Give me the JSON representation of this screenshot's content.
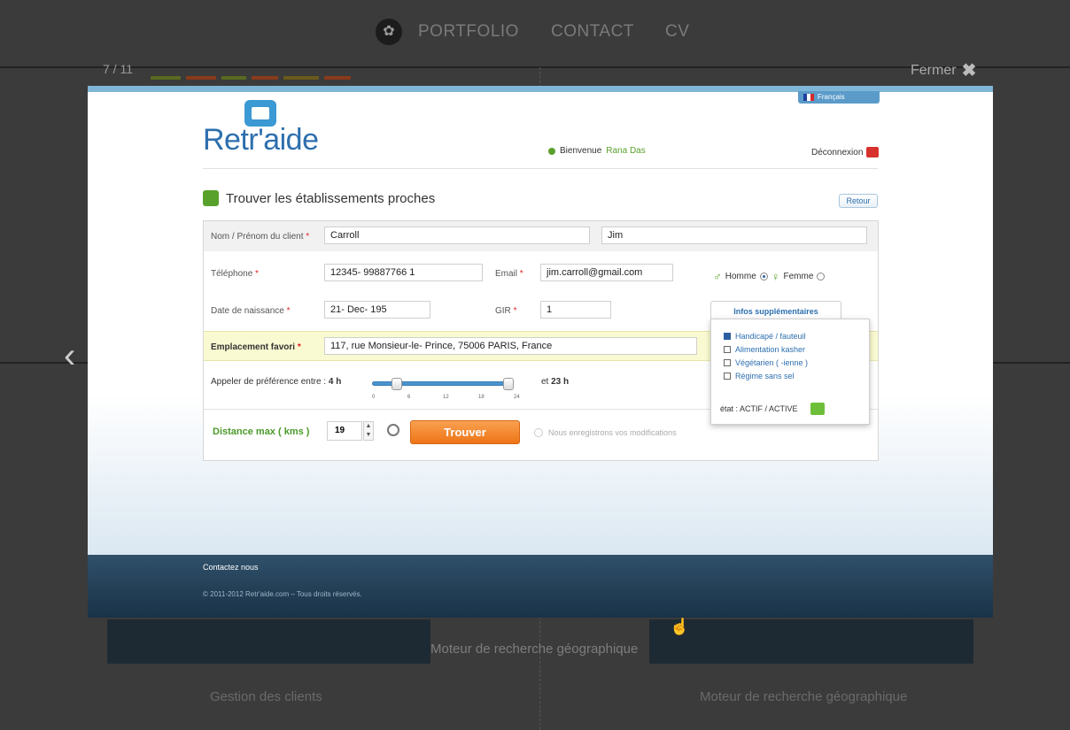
{
  "site_nav": {
    "items": [
      "PORTFOLIO",
      "CONTACT",
      "CV"
    ]
  },
  "lightbox": {
    "counter": "7 / 11",
    "close_label": "Fermer",
    "caption": "Moteur de recherche géographique",
    "prev_arrow": "‹",
    "next_arrow": "›"
  },
  "background_captions": {
    "left": "Gestion des clients",
    "right": "Moteur de recherche géographique"
  },
  "app": {
    "language": "Français",
    "brand": "Retr'aide",
    "welcome_prefix": "Bienvenue",
    "user_name": "Rana Das",
    "logout": "Déconnexion",
    "section_title": "Trouver les établissements proches",
    "back_button": "Retour",
    "form": {
      "name_label": "Nom / Prénom du client",
      "last_name": "Carroll",
      "first_name": "Jim",
      "phone_label": "Téléphone",
      "phone": "12345- 99887766 1",
      "email_label": "Email",
      "email": "jim.carroll@gmail.com",
      "gender_male": "Homme",
      "gender_female": "Femme",
      "gender_selected": "Homme",
      "birth_label": "Date de naissance",
      "birth": "21- Dec- 195",
      "gir_label": "GIR",
      "gir": "1",
      "location_label": "Emplacement favori",
      "location": "117, rue Monsieur-le- Prince, 75006 PARIS, France",
      "call_label": "Appeler de préférence entre :",
      "call_from": "4 h",
      "call_to_prefix": "et",
      "call_to": "23 h",
      "slider_ticks": [
        "0",
        "6",
        "12",
        "18",
        "24"
      ],
      "slider_range": [
        4,
        23
      ],
      "distance_label": "Distance max ( kms )",
      "distance": "19",
      "search_button": "Trouver",
      "saving_text": "Nous enregistrons vos modifications"
    },
    "extra_info": {
      "title": "Infos supplémentaires",
      "options": [
        {
          "label": "Handicapé / fauteuil",
          "checked": true
        },
        {
          "label": "Alimentation kasher",
          "checked": false
        },
        {
          "label": "Végétarien ( -ienne )",
          "checked": false
        },
        {
          "label": "Régime sans sel",
          "checked": false
        }
      ],
      "state": "état : ACTIF / ACTIVE"
    },
    "footer": {
      "contact": "Contactez nous",
      "copyright": "© 2011-2012 Retr'aide.com – Tous droits réservés."
    }
  }
}
